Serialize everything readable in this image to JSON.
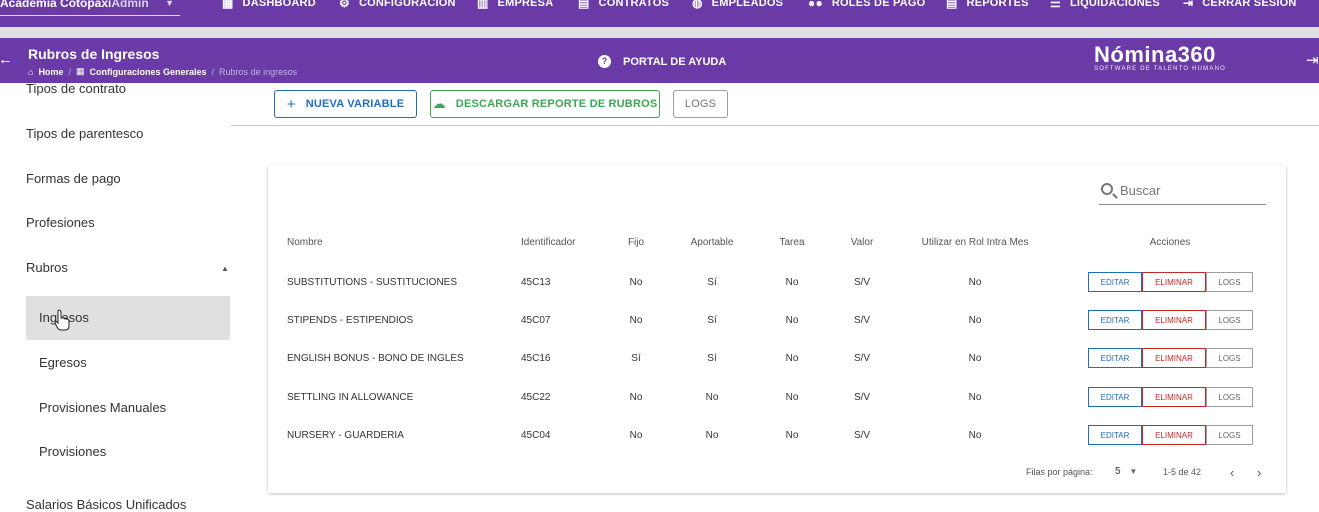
{
  "topnav": {
    "company": "Academia Cotopaxi",
    "company_suffix": "Admin",
    "items": [
      {
        "label": "DASHBOARD",
        "icon": "dashboard-icon"
      },
      {
        "label": "CONFIGURACIÓN",
        "icon": "gear-icon"
      },
      {
        "label": "EMPRESA",
        "icon": "building-icon"
      },
      {
        "label": "CONTRATOS",
        "icon": "document-icon"
      },
      {
        "label": "EMPLEADOS",
        "icon": "globe-icon"
      },
      {
        "label": "ROLES DE PAGO",
        "icon": "group-icon"
      },
      {
        "label": "REPORTES",
        "icon": "report-icon"
      },
      {
        "label": "LIQUIDACIONES",
        "icon": "list-icon"
      },
      {
        "label": "CERRAR SESIÓN",
        "icon": "logout-icon"
      }
    ]
  },
  "header": {
    "title": "Rubros de Ingresos",
    "breadcrumb": [
      "Home",
      "Configuraciones Generales",
      "Rubros de ingresos"
    ],
    "help_label": "PORTAL DE AYUDA",
    "logo_name": "Nómina360",
    "logo_tagline": "SOFTWARE DE TALENTO HUMANO"
  },
  "sidebar": {
    "items": [
      "Tipos de contrato",
      "Tipos de parentesco",
      "Formas de pago",
      "Profesiones",
      "Rubros"
    ],
    "sub_items": [
      "Ingresos",
      "Egresos",
      "Provisiones Manuales",
      "Provisiones"
    ],
    "bottom_item": "Salarios Básicos Unificados"
  },
  "toolbar": {
    "new_variable": "NUEVA VARIABLE",
    "download_report": "DESCARGAR REPORTE DE RUBROS",
    "logs": "LOGS"
  },
  "table": {
    "search_placeholder": "Buscar",
    "headers": [
      "Nombre",
      "Identificador",
      "Fijo",
      "Aportable",
      "Tarea",
      "Valor",
      "Utilizar en Rol Intra Mes",
      "Acciones"
    ],
    "actions": {
      "edit": "EDITAR",
      "delete": "ELIMINAR",
      "logs": "LOGS"
    },
    "rows": [
      {
        "name": "SUBSTITUTIONS - SUSTITUCIONES",
        "id": "45C13",
        "fijo": "No",
        "aportable": "Sí",
        "tarea": "No",
        "valor": "S/V",
        "intra": "No"
      },
      {
        "name": "STIPENDS - ESTIPENDIOS",
        "id": "45C07",
        "fijo": "No",
        "aportable": "Sí",
        "tarea": "No",
        "valor": "S/V",
        "intra": "No"
      },
      {
        "name": "ENGLISH BONUS - BONO DE INGLES",
        "id": "45C16",
        "fijo": "Sí",
        "aportable": "Sí",
        "tarea": "No",
        "valor": "S/V",
        "intra": "No"
      },
      {
        "name": "SETTLING IN ALLOWANCE",
        "id": "45C22",
        "fijo": "No",
        "aportable": "No",
        "tarea": "No",
        "valor": "S/V",
        "intra": "No"
      },
      {
        "name": "NURSERY - GUARDERIA",
        "id": "45C04",
        "fijo": "No",
        "aportable": "No",
        "tarea": "No",
        "valor": "S/V",
        "intra": "No"
      }
    ],
    "pagination": {
      "rows_per_page_label": "Filas por página:",
      "rows_per_page": "5",
      "range": "1-5 de 42"
    }
  },
  "colors": {
    "primary": "#6a3aa6",
    "blue": "#1e6fc2",
    "green": "#3aa856",
    "red": "#c62828"
  }
}
